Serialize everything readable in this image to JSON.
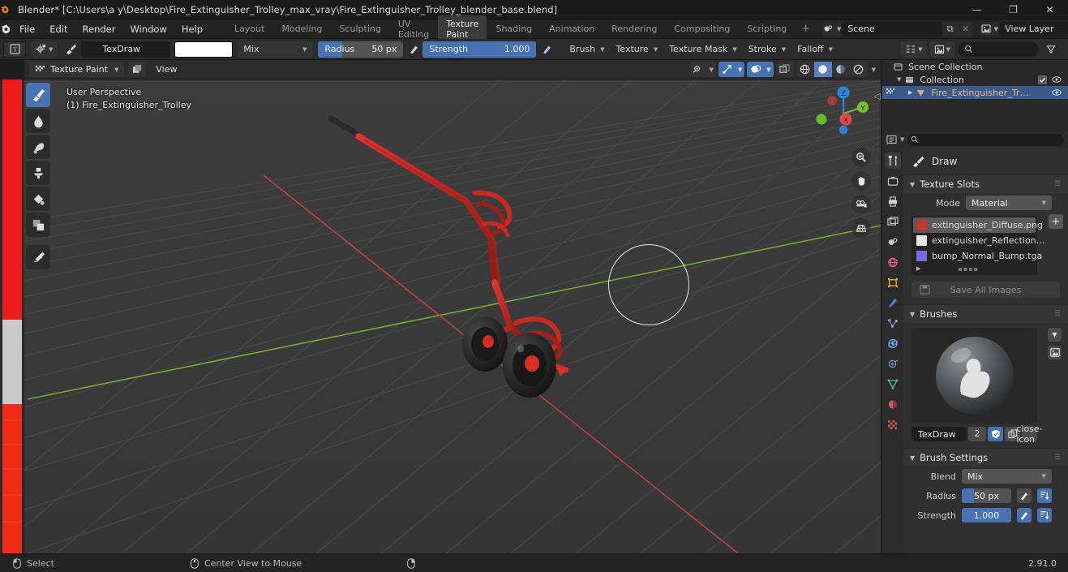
{
  "titlebar": {
    "icon": "blender-logo-icon",
    "title": "Blender* [C:\\Users\\a y\\Desktop\\Fire_Extinguisher_Trolley_max_vray\\Fire_Extinguisher_Trolley_blender_base.blend]",
    "minimize": "—",
    "maximize": "❐",
    "close": "✕"
  },
  "topbar": {
    "menus": [
      "File",
      "Edit",
      "Render",
      "Window",
      "Help"
    ],
    "workspaces": [
      {
        "label": "Layout",
        "active": false
      },
      {
        "label": "Modeling",
        "active": false
      },
      {
        "label": "Sculpting",
        "active": false
      },
      {
        "label": "UV Editing",
        "active": false
      },
      {
        "label": "Texture Paint",
        "active": true
      },
      {
        "label": "Shading",
        "active": false
      },
      {
        "label": "Animation",
        "active": false
      },
      {
        "label": "Rendering",
        "active": false
      },
      {
        "label": "Compositing",
        "active": false
      },
      {
        "label": "Scripting",
        "active": false
      }
    ],
    "add_workspace": "+",
    "scene": {
      "value": "Scene",
      "new_btn": "⧉",
      "unlink_btn": "✕"
    },
    "view_layer": {
      "value": "View Layer",
      "new_btn": "⧉",
      "unlink_btn": "✕"
    }
  },
  "toolheader": {
    "editor_type_icon": "texture-paint-editor-icon",
    "brush_preset_icon": "brush-preset-icon",
    "brush_icon": "brush-icon",
    "brush_name": "TexDraw",
    "color_swatch": "#ffffff",
    "blend_mode": "Mix",
    "radius": {
      "label": "Radius",
      "value": "50 px",
      "fill_pct": 28
    },
    "radius_pressure_icon": "pressure-icon",
    "strength": {
      "label": "Strength",
      "value": "1.000",
      "fill_pct": 100
    },
    "strength_pressure_icon": "pressure-icon",
    "menus": [
      "Brush",
      "Texture",
      "Texture Mask",
      "Stroke",
      "Falloff"
    ],
    "outliner_display_icon": "outliner-filter-icon",
    "outliner_view_icon": "outliner-image-icon",
    "search_placeholder": "",
    "filter_icon": "funnel-icon"
  },
  "viewport_header": {
    "mode": "Texture Paint",
    "mode_icon": "texture-paint-mode-icon",
    "slot_icon": "paint-slot-icon",
    "view_menu": "View",
    "right_toggles": [
      {
        "name": "visibility-icon",
        "on": false
      },
      {
        "name": "gizmo-icon",
        "on": true
      },
      {
        "name": "overlays-icon",
        "on": true
      },
      {
        "name": "xray-icon",
        "on": false
      }
    ],
    "shading_modes": [
      {
        "name": "wireframe-shading-icon",
        "on": false
      },
      {
        "name": "solid-shading-icon",
        "on": true
      },
      {
        "name": "material-preview-shading-icon",
        "on": false
      },
      {
        "name": "rendered-shading-icon",
        "on": false
      }
    ]
  },
  "viewport": {
    "overlay_line1": "User Perspective",
    "overlay_line2": "(1) Fire_Extinguisher_Trolley",
    "tools": [
      {
        "name": "draw-tool-icon",
        "active": true
      },
      {
        "name": "soften-tool-icon",
        "active": false
      },
      {
        "name": "smear-tool-icon",
        "active": false
      },
      {
        "name": "clone-tool-icon",
        "active": false
      },
      {
        "name": "fill-tool-icon",
        "active": false
      },
      {
        "name": "mask-tool-icon",
        "active": false
      },
      {
        "name": "annotate-tool-icon",
        "active": false
      }
    ],
    "nav_buttons": [
      {
        "name": "zoom-nav-icon"
      },
      {
        "name": "pan-nav-icon"
      },
      {
        "name": "camera-nav-icon"
      },
      {
        "name": "orthographic-nav-icon"
      }
    ],
    "gizmo_axes": [
      {
        "label": "Z",
        "color": "#2b87d8"
      },
      {
        "label": "Y",
        "color": "#7bbf2f"
      },
      {
        "label": "X",
        "color": "#e04a4a"
      }
    ]
  },
  "outliner": {
    "rows": [
      {
        "label": "Scene Collection",
        "indent": 0,
        "icon": "collection-icon",
        "selected": false,
        "has_disclosure": false,
        "checkbox": false,
        "eye": false
      },
      {
        "label": "Collection",
        "indent": 1,
        "icon": "collection-icon",
        "selected": false,
        "has_disclosure": true,
        "checkbox": true,
        "eye": true
      },
      {
        "label": "Fire_Extinguisher_Tr…",
        "indent": 2,
        "icon": "mesh-object-icon",
        "selected": true,
        "has_disclosure": true,
        "checkbox": false,
        "eye": true
      }
    ]
  },
  "properties": {
    "editor_icon": "properties-editor-icon",
    "browse_icon": "browse-icon",
    "search_placeholder": "",
    "tabs": [
      {
        "name": "tool-tab",
        "active": true,
        "color": "#d0d0d0"
      },
      {
        "name": "render-tab",
        "active": false,
        "color": "#cccccc"
      },
      {
        "name": "output-tab",
        "active": false,
        "color": "#cccccc"
      },
      {
        "name": "view-layer-tab",
        "active": false,
        "color": "#cccccc"
      },
      {
        "name": "scene-tab",
        "active": false,
        "color": "#cccccc"
      },
      {
        "name": "world-tab",
        "active": false,
        "color": "#e0607e"
      },
      {
        "name": "object-tab",
        "active": false,
        "color": "#e8a33d"
      },
      {
        "name": "modifiers-tab",
        "active": false,
        "color": "#4a7fd4"
      },
      {
        "name": "particles-tab",
        "active": false,
        "color": "#8fa7cf"
      },
      {
        "name": "physics-tab",
        "active": false,
        "color": "#6da8e8"
      },
      {
        "name": "constraints-tab",
        "active": false,
        "color": "#7e9fd4"
      },
      {
        "name": "object-data-tab",
        "active": false,
        "color": "#4fc48a"
      },
      {
        "name": "material-tab",
        "active": false,
        "color": "#d0576b"
      },
      {
        "name": "texture-tab",
        "active": false,
        "color": "#d35252"
      }
    ],
    "brush_header": {
      "icon": "draw-brush-icon",
      "label": "Draw"
    },
    "texture_slots": {
      "title": "Texture Slots",
      "mode_label": "Mode",
      "mode_value": "Material",
      "add_button": "+",
      "slots": [
        {
          "label": "extinguisher_Diffuse.png",
          "thumb": "#c4352c",
          "selected": true
        },
        {
          "label": "extinguisher_Reflection…",
          "thumb": "#e6e6e6",
          "selected": false
        },
        {
          "label": "bump_Normal_Bump.tga",
          "thumb": "#6e6ee0",
          "selected": false
        }
      ],
      "save_all_label": "Save All Images",
      "save_all_icon": "save-image-icon"
    },
    "brushes": {
      "title": "Brushes",
      "name": "TexDraw",
      "users": "2",
      "fake_user_icon": "shield-icon",
      "duplicate_icon": "duplicate-icon",
      "delete_icon": "close-icon",
      "dropdown_icon": "chevron-down-icon",
      "preview_icon": "image-preview-icon"
    },
    "brush_settings": {
      "title": "Brush Settings",
      "blend_label": "Blend",
      "blend_value": "Mix",
      "radius_label": "Radius",
      "radius_value": "50 px",
      "radius_fill_pct": 24,
      "strength_label": "Strength",
      "strength_value": "1.000",
      "strength_fill_pct": 100,
      "pressure_icon": "pressure-icon",
      "unified_icon": "unified-settings-icon"
    }
  },
  "statusbar": {
    "items": [
      {
        "icon": "mouse-left-icon",
        "label": "Select"
      },
      {
        "icon": "mouse-middle-icon",
        "label": "Center View to Mouse"
      },
      {
        "icon": "mouse-right-icon",
        "label": ""
      }
    ],
    "version": "2.91.0"
  }
}
